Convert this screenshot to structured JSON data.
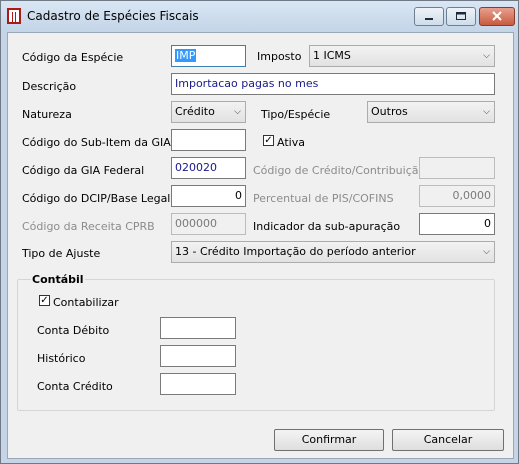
{
  "window": {
    "title": "Cadastro de Espécies Fiscais"
  },
  "titlebar_buttons": {
    "minimize_icon": "minimize-icon",
    "maximize_icon": "maximize-icon",
    "close_icon": "close-icon"
  },
  "form": {
    "codigo_especie": {
      "label": "Código da Espécie",
      "value": "IMP"
    },
    "imposto": {
      "label": "Imposto",
      "value": "1 ICMS"
    },
    "descricao": {
      "label": "Descrição",
      "value": "Importacao pagas no mes"
    },
    "natureza": {
      "label": "Natureza",
      "value": "Crédito"
    },
    "tipo_especie": {
      "label": "Tipo/Espécie",
      "value": "Outros"
    },
    "codigo_subitem_gia": {
      "label": "Código do Sub-Item da GIA",
      "value": ""
    },
    "ativa": {
      "label": "Ativa",
      "checked": true
    },
    "codigo_gia_federal": {
      "label": "Código da GIA Federal",
      "value": "020020"
    },
    "codigo_credito_contribuicao": {
      "label": "Código de Crédito/Contribuição",
      "value": ""
    },
    "codigo_dcip": {
      "label": "Código do DCIP/Base Legal",
      "value": "0"
    },
    "percentual_pis_cofins": {
      "label": "Percentual de PIS/COFINS",
      "value": "0,0000"
    },
    "codigo_receita_cprb": {
      "label": "Código da Receita CPRB",
      "value": "000000"
    },
    "indicador_subapuracao": {
      "label": "Indicador da sub-apuração",
      "value": "0"
    },
    "tipo_ajuste": {
      "label": "Tipo de Ajuste",
      "value": "13 - Crédito Importação do período anterior"
    }
  },
  "contabil": {
    "title": "Contábil",
    "contabilizar": {
      "label": "Contabilizar",
      "checked": true
    },
    "conta_debito": {
      "label": "Conta Débito",
      "value": ""
    },
    "historico": {
      "label": "Histórico",
      "value": ""
    },
    "conta_credito": {
      "label": "Conta Crédito",
      "value": ""
    }
  },
  "buttons": {
    "confirmar": "Confirmar",
    "cancelar": "Cancelar"
  },
  "colors": {
    "title_bar": "#c5d5e7",
    "close_button": "#c75b3f",
    "selection": "#3399ff"
  }
}
